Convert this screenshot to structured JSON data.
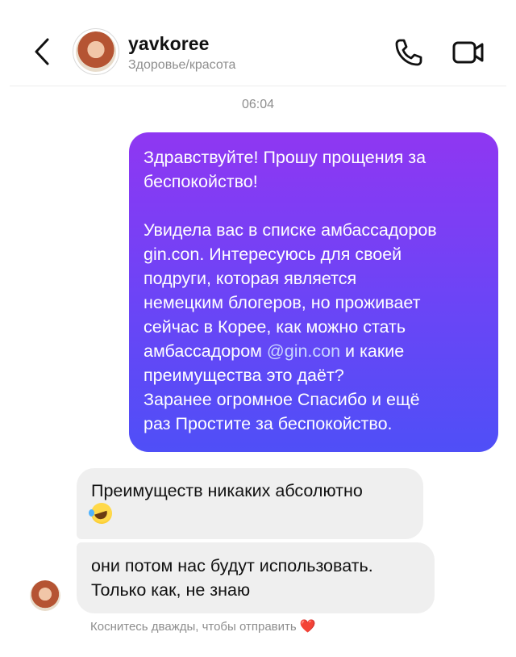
{
  "header": {
    "username": "yavkoree",
    "category": "Здоровье/красота"
  },
  "icons": {
    "back": "chevron-left-icon",
    "call": "phone-icon",
    "video": "video-camera-icon",
    "emoji": "rolling-on-floor-laughing-emoji",
    "heart": "red-heart-icon"
  },
  "colors": {
    "outgoing_gradient_top": "#8f37f2",
    "outgoing_gradient_bottom": "#4f4ff7",
    "incoming_bubble": "#efefef",
    "muted_text": "#8e8e8e"
  },
  "thread": {
    "timestamp": "06:04",
    "outgoing": {
      "line1": "Здравствуйте! Прошу прощения за",
      "line2": "беспокойство!",
      "line3": "Увидела вас в списке амбассадоров",
      "line4": "gin.con. Интересуюсь для своей",
      "line5": "подруги, которая является",
      "line6": "немецким блогеров, но проживает",
      "line7": "сейчас в Корее, как можно стать",
      "line8_before": "амбассадором ",
      "mention": "@gin.con",
      "line8_after": " и какие",
      "line9": "преимущества это даёт?",
      "line10": "Заранее огромное Спасибо и ещё",
      "line11": "раз Простите за беспокойство."
    },
    "incoming": [
      {
        "line1": "Преимуществ никаких абсолютно"
      },
      {
        "line1": "они потом нас будут использовать.",
        "line2": "Только как, не знаю"
      }
    ],
    "hint": "Коснитесь дважды, чтобы отправить",
    "hint_heart": "❤️"
  }
}
